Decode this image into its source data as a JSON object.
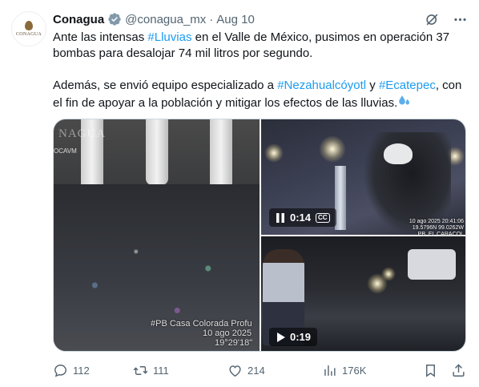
{
  "author": {
    "name": "Conagua",
    "handle": "@conagua_mx",
    "date": "Aug 10",
    "avatar_text": "CONAGUA"
  },
  "tweet": {
    "p1_before": "Ante las intensas ",
    "p1_tag": "#Lluvias",
    "p1_after": " en el Valle de México, pusimos en operación 37 bombas para desalojar 74 mil litros por segundo.",
    "p2_before": "Además, se envió equipo especializado a ",
    "p2_tag1": "#Nezahualcóyotl",
    "p2_mid": " y ",
    "p2_tag2": "#Ecatepec",
    "p2_after": ", con el fin de apoyar a la población y mitigar los efectos de las lluvias."
  },
  "media": {
    "left_watermark": "NAGUA",
    "left_sub": "OCAVM",
    "left_caption_1": "#PB Casa Colorada Profu",
    "left_caption_2": "10 ago 2025 ",
    "left_caption_3": "19°29'18\"",
    "video1_time": "0:14",
    "video1_cc": "CC",
    "video1_stamp_1": "10 ago 2025 20:41:06",
    "video1_stamp_2": "19.5796N 99.0262W",
    "video1_stamp_3": "PB. EL CARACOL",
    "video2_time": "0:19"
  },
  "actions": {
    "replies": "112",
    "reposts": "111",
    "likes": "214",
    "views": "176K"
  },
  "colors": {
    "link": "#1d9bf0",
    "verified": "#829aab",
    "muted": "#536471"
  }
}
